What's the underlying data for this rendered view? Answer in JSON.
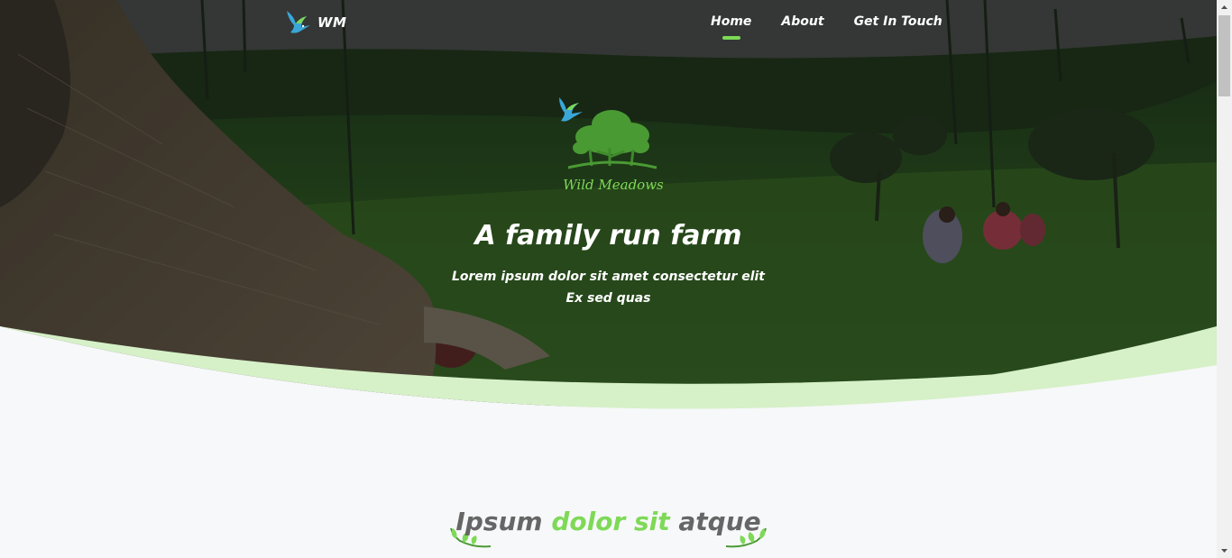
{
  "nav": {
    "brand": "WM",
    "menu": [
      {
        "label": "Home",
        "active": true
      },
      {
        "label": "About",
        "active": false
      },
      {
        "label": "Get In Touch",
        "active": false
      }
    ]
  },
  "hero": {
    "logo_text": "Wild Meadows",
    "title": "A family run farm",
    "subtitle_line1": "Lorem ipsum dolor sit amet consectetur elit",
    "subtitle_line2": "Ex sed quas"
  },
  "section": {
    "title_part1": "Ipsum ",
    "title_highlight": "dolor sit",
    "title_part2": " atque"
  },
  "colors": {
    "accent": "#7ed957",
    "wave": "#d6f0c8",
    "page_bg": "#f7f8fa"
  }
}
